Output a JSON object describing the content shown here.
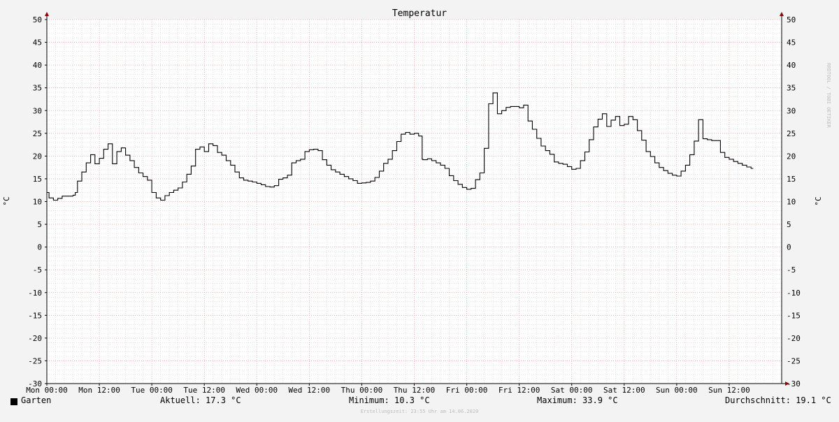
{
  "chart_data": {
    "type": "line",
    "title": "Temperatur",
    "ylabel": "°C",
    "ylim": [
      -30,
      50
    ],
    "yticks": [
      50,
      45,
      40,
      35,
      30,
      25,
      20,
      15,
      10,
      5,
      0,
      -5,
      -10,
      -15,
      -20,
      -25,
      -30
    ],
    "xlim_hours": [
      0,
      168
    ],
    "xticks": [
      {
        "label": "Mon 00:00",
        "hour": 0
      },
      {
        "label": "Mon 12:00",
        "hour": 12
      },
      {
        "label": "Tue 00:00",
        "hour": 24
      },
      {
        "label": "Tue 12:00",
        "hour": 36
      },
      {
        "label": "Wed 00:00",
        "hour": 48
      },
      {
        "label": "Wed 12:00",
        "hour": 60
      },
      {
        "label": "Thu 00:00",
        "hour": 72
      },
      {
        "label": "Thu 12:00",
        "hour": 84
      },
      {
        "label": "Fri 00:00",
        "hour": 96
      },
      {
        "label": "Fri 12:00",
        "hour": 108
      },
      {
        "label": "Sat 00:00",
        "hour": 120
      },
      {
        "label": "Sat 12:00",
        "hour": 132
      },
      {
        "label": "Sun 00:00",
        "hour": 144
      },
      {
        "label": "Sun 12:00",
        "hour": 156
      }
    ],
    "grid": true,
    "series": [
      {
        "name": "Garten",
        "color": "#000000",
        "step": true,
        "points": [
          [
            0,
            12.0
          ],
          [
            0.5,
            10.8
          ],
          [
            1.5,
            10.3
          ],
          [
            2.5,
            10.7
          ],
          [
            3.5,
            11.2
          ],
          [
            6,
            11.4
          ],
          [
            6.5,
            12.0
          ],
          [
            7,
            14.5
          ],
          [
            8,
            16.5
          ],
          [
            9,
            18.5
          ],
          [
            10,
            20.3
          ],
          [
            11,
            18.3
          ],
          [
            12,
            19.5
          ],
          [
            13,
            21.5
          ],
          [
            14,
            22.7
          ],
          [
            15,
            18.3
          ],
          [
            16,
            21.0
          ],
          [
            17,
            21.8
          ],
          [
            18,
            20.2
          ],
          [
            19,
            19.0
          ],
          [
            20,
            17.5
          ],
          [
            21,
            16.3
          ],
          [
            22,
            15.5
          ],
          [
            23,
            14.7
          ],
          [
            24,
            12.0
          ],
          [
            25,
            10.8
          ],
          [
            26,
            10.3
          ],
          [
            27,
            11.3
          ],
          [
            28,
            12.0
          ],
          [
            29,
            12.5
          ],
          [
            30,
            13.0
          ],
          [
            31,
            14.3
          ],
          [
            32,
            16.0
          ],
          [
            33,
            17.8
          ],
          [
            34,
            21.5
          ],
          [
            35,
            22.0
          ],
          [
            36,
            21.0
          ],
          [
            37,
            22.7
          ],
          [
            38,
            22.3
          ],
          [
            39,
            20.8
          ],
          [
            40,
            20.2
          ],
          [
            41,
            19.0
          ],
          [
            42,
            18.0
          ],
          [
            43,
            16.5
          ],
          [
            44,
            15.2
          ],
          [
            45,
            14.7
          ],
          [
            46,
            14.5
          ],
          [
            47,
            14.3
          ],
          [
            48,
            14.0
          ],
          [
            49,
            13.7
          ],
          [
            50,
            13.3
          ],
          [
            51,
            13.2
          ],
          [
            52,
            13.5
          ],
          [
            53,
            14.9
          ],
          [
            54,
            15.2
          ],
          [
            55,
            15.8
          ],
          [
            56,
            18.5
          ],
          [
            57,
            19.0
          ],
          [
            58,
            19.3
          ],
          [
            59,
            21.0
          ],
          [
            60,
            21.4
          ],
          [
            61,
            21.5
          ],
          [
            62,
            21.2
          ],
          [
            63,
            19.2
          ],
          [
            64,
            18.0
          ],
          [
            65,
            17.0
          ],
          [
            66,
            16.5
          ],
          [
            67,
            16.0
          ],
          [
            68,
            15.5
          ],
          [
            69,
            15.0
          ],
          [
            70,
            14.6
          ],
          [
            71,
            14.0
          ],
          [
            72,
            14.1
          ],
          [
            73,
            14.2
          ],
          [
            74,
            14.5
          ],
          [
            75,
            15.3
          ],
          [
            76,
            16.7
          ],
          [
            77,
            18.4
          ],
          [
            78,
            19.3
          ],
          [
            79,
            21.2
          ],
          [
            80,
            23.2
          ],
          [
            81,
            24.8
          ],
          [
            82,
            25.2
          ],
          [
            83,
            24.8
          ],
          [
            84,
            25.0
          ],
          [
            85,
            24.4
          ],
          [
            85.8,
            19.3
          ],
          [
            86,
            19.2
          ],
          [
            87,
            19.4
          ],
          [
            88,
            19.0
          ],
          [
            89,
            18.5
          ],
          [
            90,
            18.0
          ],
          [
            91,
            17.3
          ],
          [
            92,
            15.7
          ],
          [
            93,
            14.6
          ],
          [
            94,
            13.8
          ],
          [
            95,
            13.1
          ],
          [
            96,
            12.7
          ],
          [
            97,
            12.9
          ],
          [
            98,
            14.8
          ],
          [
            99,
            16.3
          ],
          [
            100,
            21.7
          ],
          [
            101,
            31.5
          ],
          [
            102,
            33.9
          ],
          [
            103,
            29.3
          ],
          [
            104,
            30.0
          ],
          [
            105,
            30.7
          ],
          [
            106,
            30.9
          ],
          [
            108,
            30.6
          ],
          [
            109,
            31.2
          ],
          [
            110,
            27.7
          ],
          [
            111,
            25.9
          ],
          [
            112,
            23.9
          ],
          [
            113,
            22.2
          ],
          [
            114,
            21.2
          ],
          [
            115,
            20.4
          ],
          [
            116,
            18.7
          ],
          [
            117,
            18.4
          ],
          [
            118,
            18.2
          ],
          [
            119,
            17.7
          ],
          [
            120,
            17.1
          ],
          [
            121,
            17.3
          ],
          [
            122,
            19.0
          ],
          [
            123,
            20.9
          ],
          [
            124,
            23.6
          ],
          [
            125,
            26.4
          ],
          [
            126,
            28.1
          ],
          [
            127,
            29.3
          ],
          [
            128,
            26.5
          ],
          [
            129,
            27.9
          ],
          [
            130,
            28.7
          ],
          [
            131,
            26.7
          ],
          [
            132,
            27.0
          ],
          [
            133,
            28.7
          ],
          [
            134,
            28.0
          ],
          [
            135,
            25.6
          ],
          [
            136,
            23.5
          ],
          [
            137,
            21.0
          ],
          [
            138,
            19.9
          ],
          [
            139,
            18.5
          ],
          [
            140,
            17.5
          ],
          [
            141,
            16.8
          ],
          [
            142,
            16.2
          ],
          [
            143,
            15.8
          ],
          [
            144,
            15.6
          ],
          [
            145,
            16.7
          ],
          [
            146,
            18.0
          ],
          [
            147,
            20.3
          ],
          [
            148,
            23.3
          ],
          [
            149,
            28.0
          ],
          [
            150,
            23.8
          ],
          [
            151,
            23.6
          ],
          [
            152,
            23.4
          ],
          [
            154,
            20.8
          ],
          [
            155,
            19.7
          ],
          [
            156,
            19.3
          ],
          [
            157,
            18.8
          ],
          [
            158,
            18.4
          ],
          [
            159,
            18.0
          ],
          [
            160,
            17.6
          ],
          [
            161,
            17.3
          ],
          [
            161.5,
            17.3
          ]
        ]
      }
    ],
    "legend": {
      "series_name": "Garten",
      "current_label": "Aktuell:",
      "current_value": "17.3 °C",
      "minimum_label": "Minimum:",
      "minimum_value": "10.3 °C",
      "maximum_label": "Maximum:",
      "maximum_value": "33.9 °C",
      "average_label": "Durchschnitt:",
      "average_value": "19.1 °C"
    },
    "footer": "Erstellungszeit: 23:55 Uhr am 14.06.2020",
    "watermark": "RRDTOOL / TOBI OETIKER",
    "colors": {
      "background": "#f3f3f3",
      "plot_background": "#ffffff",
      "major_grid": "#e8a0a0",
      "minor_grid": "#cfcfcf",
      "axis": "#000000",
      "arrow": "#8b0000",
      "line": "#000000"
    }
  }
}
